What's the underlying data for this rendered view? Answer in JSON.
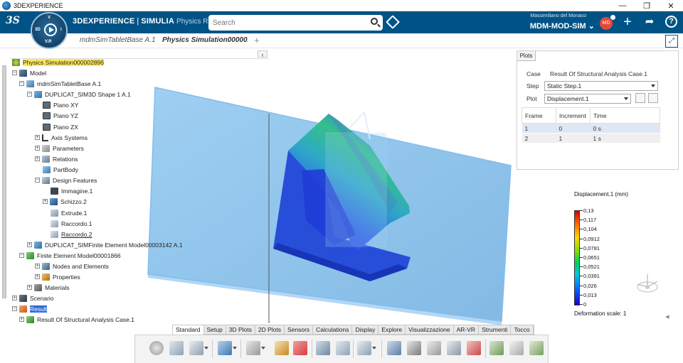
{
  "window": {
    "title": "3DEXPERIENCE"
  },
  "header": {
    "brand_prefix": "3DEXPERIENCE",
    "brand_separator": " | ",
    "brand_product": "SIMULIA",
    "brand_app": "Physics R...",
    "search_placeholder": "Search",
    "user_name": "Massimiliano del Monaco",
    "tenant": "MDM-MOD-SIM",
    "tenant_chevron": "⌄",
    "avatar_initials": "MD",
    "plus_label": "+",
    "share_label": "➦",
    "help_label": "?",
    "ds_logo": "3S",
    "compass_labels": {
      "north": "V",
      "west": "3D",
      "south": "V.R",
      "east": "i"
    }
  },
  "doc_tabs": [
    {
      "label": "mdmSimTabletBase A.1",
      "active": false
    },
    {
      "label": "Physics Simulation000002",
      "active": true
    }
  ],
  "tab_add": "+",
  "tree": {
    "nodes": [
      {
        "label": "Physics Simulation00000289б"
      },
      {
        "label": "Model"
      },
      {
        "label": "mdmSimTabletBase A.1"
      },
      {
        "label": "DUPLICAT_SIM3D Shape 1 A.1"
      },
      {
        "label": "Piano XY"
      },
      {
        "label": "Piano YZ"
      },
      {
        "label": "Piano ZX"
      },
      {
        "label": "Axis Systems"
      },
      {
        "label": "Parameters"
      },
      {
        "label": "Relations"
      },
      {
        "label": "PartBody"
      },
      {
        "label": "Design Features"
      },
      {
        "label": "Immagine.1"
      },
      {
        "label": "Schizzo.2"
      },
      {
        "label": "Extrude.1"
      },
      {
        "label": "Raccordo.1"
      },
      {
        "label": "Raccordo.2"
      },
      {
        "label": "DUPLICAT_SIMFinite Element Model00003142 A.1"
      },
      {
        "label": "Finite Element Model00001866"
      },
      {
        "label": "Nodes and Elements"
      },
      {
        "label": "Properties"
      },
      {
        "label": "Materials"
      },
      {
        "label": "Scenario"
      },
      {
        "label": "Result"
      },
      {
        "label": "Result Of Structural Analysis Case.1"
      }
    ]
  },
  "plots": {
    "tab_label": "Plots",
    "case_label": "Case",
    "case_value": "Result Of Structural Analysis Case.1",
    "step_label": "Step",
    "step_value": "Static Step.1",
    "plot_label": "Plot",
    "plot_value": "Displacement.1",
    "columns": [
      "Frame",
      "Increment",
      "Time"
    ],
    "rows": [
      {
        "frame": "1",
        "increment": "0",
        "time": "0 s"
      },
      {
        "frame": "2",
        "increment": "1",
        "time": "1 s"
      }
    ]
  },
  "legend": {
    "title": "Displacement.1 (mm)",
    "values": [
      "0,13",
      "0,117",
      "0,104",
      "0,0912",
      "0,0781",
      "0,0651",
      "0,0521",
      "0,0391",
      "0,026",
      "0,013",
      "0"
    ],
    "deformation": "Deformation scale: 1",
    "colors": {
      "max": "#d40000",
      "min": "#1a00c8"
    }
  },
  "command_tabs": [
    {
      "label": "Standard",
      "active": true
    },
    {
      "label": "Setup",
      "active": false
    },
    {
      "label": "3D Plots",
      "active": false
    },
    {
      "label": "2D Plots",
      "active": false
    },
    {
      "label": "Sensors",
      "active": false
    },
    {
      "label": "Calculations",
      "active": false
    },
    {
      "label": "Display",
      "active": false
    },
    {
      "label": "Explore",
      "active": false
    },
    {
      "label": "Visualizzazione",
      "active": false
    },
    {
      "label": "AR-VR",
      "active": false
    },
    {
      "label": "Strumenti",
      "active": false
    },
    {
      "label": "Tocco",
      "active": false
    }
  ],
  "theme": {
    "topbar": "#005386",
    "accent": "#2d6bd6",
    "highlight": "#ffe95a"
  }
}
